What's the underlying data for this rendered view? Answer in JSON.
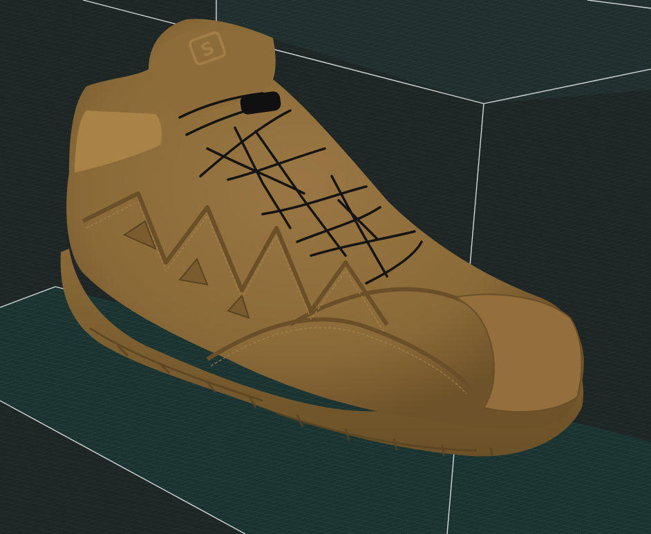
{
  "viewport": {
    "kind": "3d-model-viewer",
    "model": "trail-boot",
    "logo_text": "S",
    "colors": {
      "background": "#1e2525",
      "grid_floor": "#1b3532",
      "grid_line": "#5f8a84",
      "bounding_box": "#e8ecec",
      "boot_upper": "#8c6b3a",
      "boot_sole": "#7f6232",
      "laces": "#141414"
    }
  }
}
